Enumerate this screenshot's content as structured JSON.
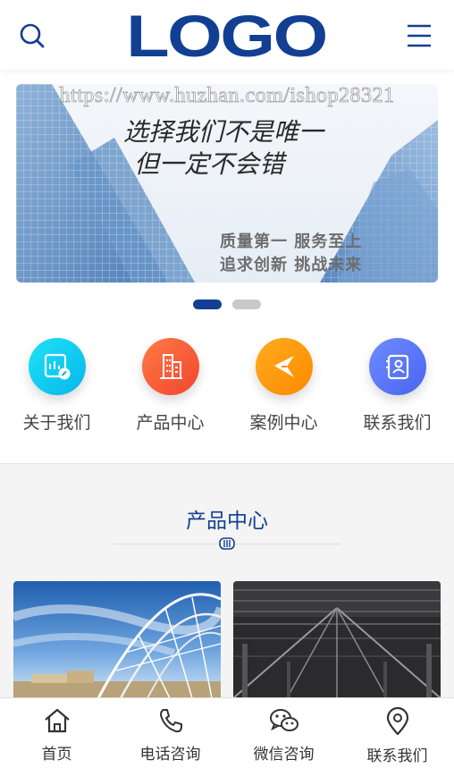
{
  "header": {
    "logo_text": "LOGO",
    "search_icon": "search-icon",
    "menu_icon": "hamburger-menu-icon"
  },
  "banner": {
    "watermark": "https://www.huzhan.com/ishop28321",
    "slogan_line1": "选择我们不是唯一",
    "slogan_line2": "但一定不会错",
    "slogan_line3": "质量第一  服务至上",
    "slogan_line4": "追求创新  挑战未来",
    "slides_total": 2,
    "active_slide": 1
  },
  "quick_nav": [
    {
      "label": "关于我们",
      "icon": "certificate-icon",
      "color_from": "#1ee3f5",
      "color_to": "#07b6ea"
    },
    {
      "label": "产品中心",
      "icon": "building-icon",
      "color_from": "#ff7a45",
      "color_to": "#f2452e"
    },
    {
      "label": "案例中心",
      "icon": "cases-icon",
      "color_from": "#ffab1f",
      "color_to": "#ff8a00"
    },
    {
      "label": "联系我们",
      "icon": "contact-card-icon",
      "color_from": "#6e8cff",
      "color_to": "#4964f0"
    }
  ],
  "products": {
    "title": "产品中心",
    "title_icon": "film-reel-icon",
    "items": [
      {
        "image": "steel-arch-structure-photo"
      },
      {
        "image": "steel-warehouse-roof-photo"
      }
    ]
  },
  "bottom_nav": [
    {
      "label": "首页",
      "icon": "home-icon"
    },
    {
      "label": "电话咨询",
      "icon": "phone-icon"
    },
    {
      "label": "微信咨询",
      "icon": "wechat-icon"
    },
    {
      "label": "联系我们",
      "icon": "location-pin-icon"
    }
  ],
  "colors": {
    "brand": "#123f93",
    "text": "#444444",
    "section_bg": "#f4f4f4",
    "dot_inactive": "#c9c9c9"
  }
}
